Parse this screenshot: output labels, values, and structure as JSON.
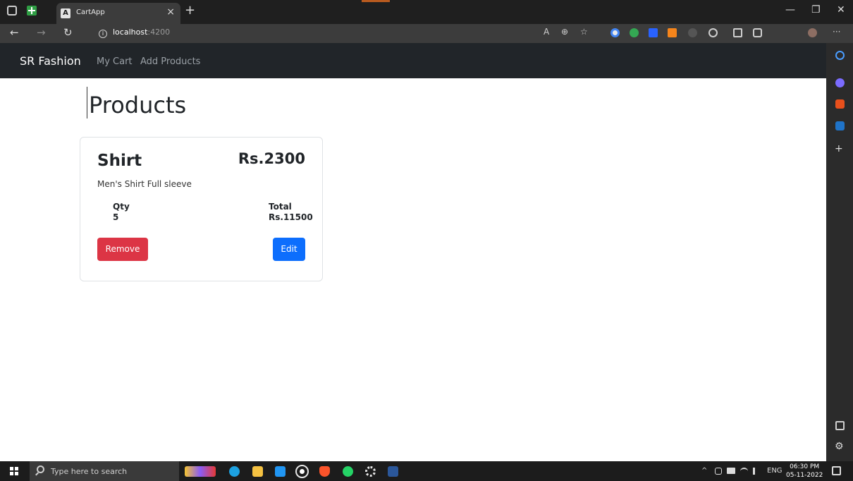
{
  "browser": {
    "tab_title": "CartApp",
    "tab_favicon": "A",
    "url_host": "localhost",
    "url_port": ":4200",
    "close_glyph": "×",
    "new_tab_glyph": "+",
    "minimize_glyph": "—",
    "restore_glyph": "❐",
    "window_close_glyph": "✕",
    "back_glyph": "←",
    "forward_glyph": "→",
    "reload_glyph": "↻",
    "more_glyph": "···",
    "read_aloud_glyph": "A",
    "zoom_glyph": "⊕",
    "favorite_glyph": "☆"
  },
  "navbar": {
    "brand": "SR Fashion",
    "links": [
      "My Cart",
      "Add Products"
    ]
  },
  "page": {
    "title": "Products"
  },
  "product": {
    "name": "Shirt",
    "price": "Rs.2300",
    "description": "Men's Shirt Full sleeve",
    "qty_label": "Qty",
    "qty_value": "5",
    "total_label": "Total",
    "total_value": "Rs.11500",
    "remove_label": "Remove",
    "edit_label": "Edit"
  },
  "sidebar": {
    "add_glyph": "+",
    "settings_glyph": "⚙"
  },
  "taskbar": {
    "search_placeholder": "Type here to search",
    "language": "ENG",
    "time": "06:30 PM",
    "date": "05-11-2022",
    "tray_chevron": "^"
  },
  "colors": {
    "navbar_bg": "#212529",
    "remove_button": "#dc3545",
    "edit_button": "#0d6efd"
  }
}
